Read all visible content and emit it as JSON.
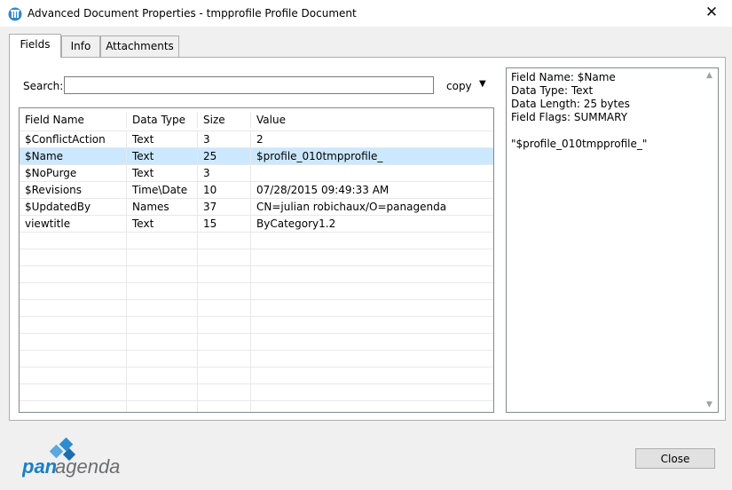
{
  "window": {
    "title": "Advanced Document Properties - tmpprofile Profile Document",
    "close_glyph": "✕"
  },
  "tabs": [
    {
      "label": "Fields",
      "active": true
    },
    {
      "label": "Info",
      "active": false
    },
    {
      "label": "Attachments",
      "active": false
    }
  ],
  "search": {
    "label": "Search:",
    "value": "",
    "copy_label": "copy",
    "copy_arrow": "▼"
  },
  "table": {
    "headers": [
      "Field Name",
      "Data Type",
      "Size",
      "Value"
    ],
    "rows": [
      [
        "$ConflictAction",
        "Text",
        "3",
        "2"
      ],
      [
        "$Name",
        "Text",
        "25",
        "$profile_010tmpprofile_"
      ],
      [
        "$NoPurge",
        "Text",
        "3",
        ""
      ],
      [
        "$Revisions",
        "Time\\Date",
        "10",
        "07/28/2015 09:49:33 AM"
      ],
      [
        "$UpdatedBy",
        "Names",
        "37",
        "CN=julian robichaux/O=panagenda"
      ],
      [
        "viewtitle",
        "Text",
        "15",
        "ByCategory1.2"
      ]
    ],
    "selected_row": 1
  },
  "details": {
    "field_name": "Field Name: $Name",
    "data_type": "Data Type: Text",
    "data_length": "Data Length: 25 bytes",
    "field_flags": "Field Flags: SUMMARY",
    "value": "\"$profile_010tmpprofile_\""
  },
  "logo": {
    "text_pan": "pan",
    "text_agenda": "agenda",
    "colors": {
      "blue": "#1b7fc4",
      "gray": "#6d6e71"
    }
  },
  "buttons": {
    "close_label": "Close"
  },
  "colors": {
    "selection": "#cce8ff",
    "accent": "#0078d7"
  }
}
